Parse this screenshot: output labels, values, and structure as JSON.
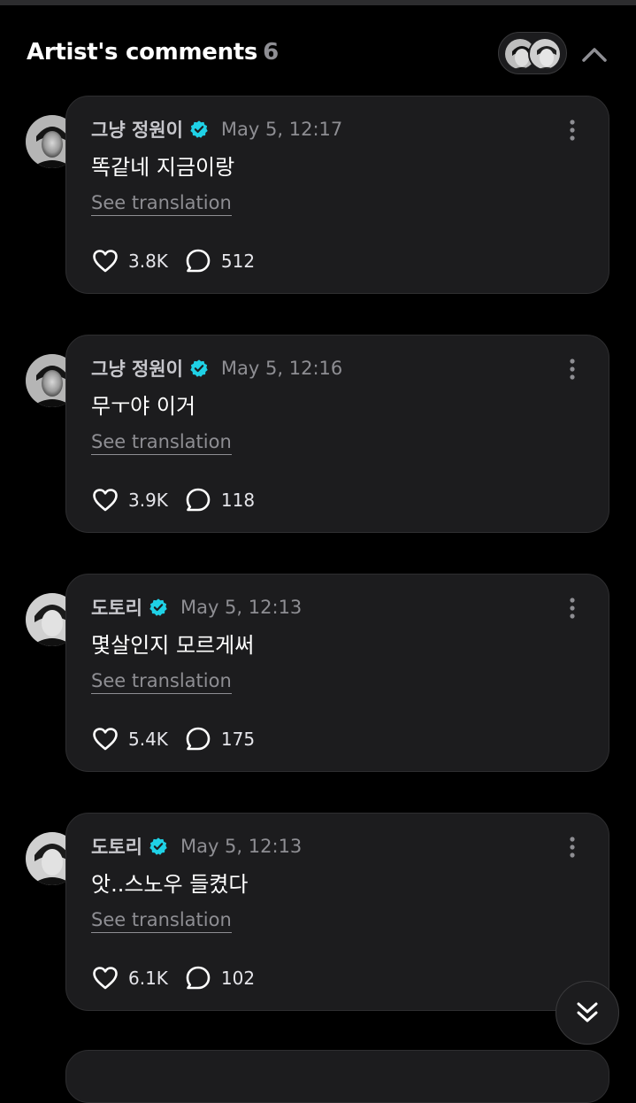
{
  "header": {
    "title": "Artist's comments",
    "count": "6"
  },
  "icons": {
    "verified_color": "#1fd1e6",
    "heart": "heart-icon",
    "reply": "comment-bubble-icon",
    "more": "more-vertical-icon",
    "collapse": "chevron-up-icon",
    "scroll_down": "double-chevron-down-icon"
  },
  "comments": [
    {
      "author": "그냥 정원이",
      "time": "May 5, 12:17",
      "text": "똑같네 지금이랑",
      "translate_label": "See translation",
      "likes": "3.8K",
      "replies": "512"
    },
    {
      "author": "그냥 정원이",
      "time": "May 5, 12:16",
      "text": "무ㅜ야 이거",
      "translate_label": "See translation",
      "likes": "3.9K",
      "replies": "118"
    },
    {
      "author": "도토리",
      "time": "May 5, 12:13",
      "text": "몇살인지 모르게써",
      "translate_label": "See translation",
      "likes": "5.4K",
      "replies": "175"
    },
    {
      "author": "도토리",
      "time": "May 5, 12:13",
      "text": "앗..스노우 들켰다",
      "translate_label": "See translation",
      "likes": "6.1K",
      "replies": "102"
    }
  ]
}
